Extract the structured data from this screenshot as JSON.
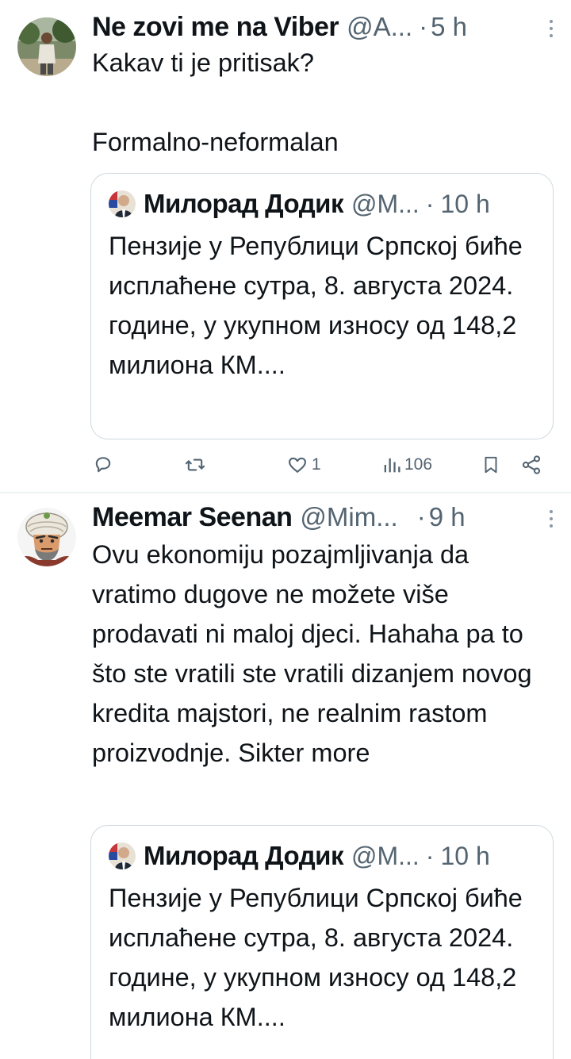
{
  "tweets": [
    {
      "author_name": "Ne zovi me na Viber",
      "handle": "@A...",
      "dot": "·",
      "time": "5 h",
      "text": "Kakav ti je pritisak?\n\nFormalno-neformalan",
      "quote": {
        "author_name": "Милорад Додик",
        "handle": "@M...",
        "dot": "·",
        "time": "10 h",
        "text": "Пензије у Републици Српској биће исплаћене сутра, 8. августа 2024. године, у укупном износу од 148,2 милиона КМ...."
      },
      "actions": {
        "reply_count": "",
        "retweet_count": "",
        "like_count": "1",
        "view_count": "106"
      }
    },
    {
      "author_name": "Meemar Seenan",
      "handle": "@Mim...",
      "dot": "·",
      "time": "9 h",
      "text": "Ovu ekonomiju pozajmljivanja da vratimo dugove ne možete više prodavati ni maloj djeci. Hahaha pa to što ste vratili ste vratili dizanjem novog kredita majstori, ne realnim rastom proizvodnje. Sikter more",
      "quote": {
        "author_name": "Милорад Додик",
        "handle": "@M...",
        "dot": "·",
        "time": "10 h",
        "text": "Пензије у Републици Српској биће исплаћене сутра, 8. августа 2024. године, у укупном износу од 148,2 милиона КМ...."
      }
    }
  ],
  "icons": {
    "reply": "reply-icon",
    "retweet": "retweet-icon",
    "like": "heart-icon",
    "views": "views-icon",
    "bookmark": "bookmark-icon",
    "share": "share-icon",
    "more": "more-vertical-icon"
  },
  "colors": {
    "text": "#0f1419",
    "secondary": "#536471",
    "border": "#cfd9de"
  }
}
